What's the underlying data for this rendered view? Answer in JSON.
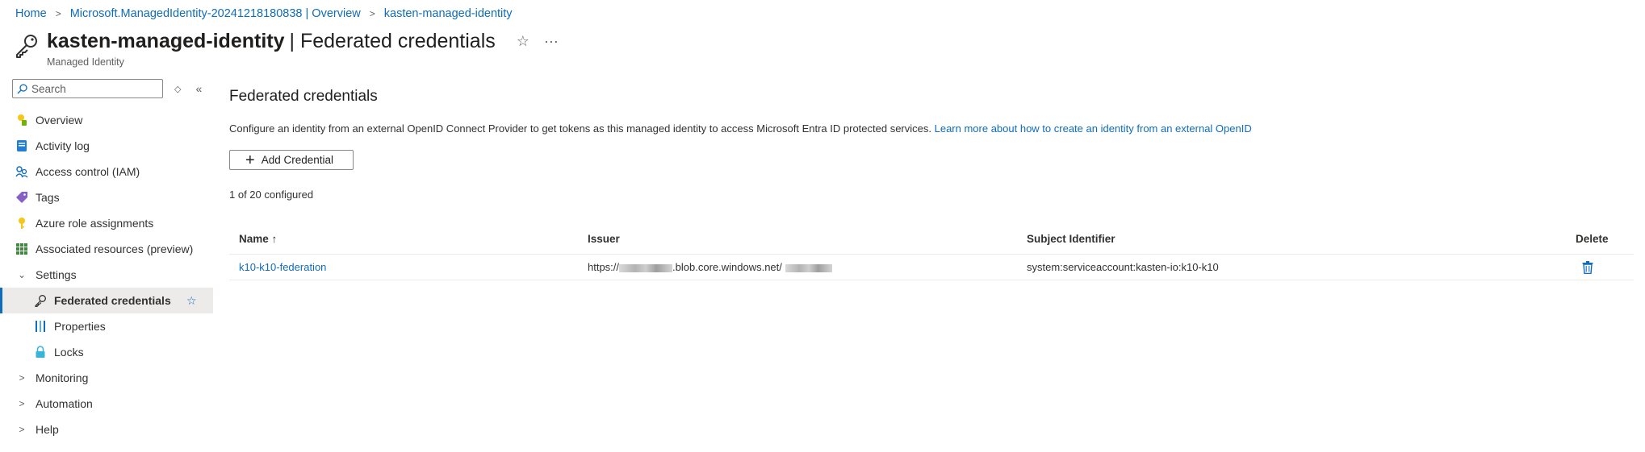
{
  "breadcrumb": {
    "home": "Home",
    "overview": "Microsoft.ManagedIdentity-20241218180838 | Overview",
    "current": "kasten-managed-identity"
  },
  "header": {
    "resource_name": "kasten-managed-identity",
    "page_name": "| Federated credentials",
    "subtitle": "Managed Identity",
    "favorite_icon": "star-icon",
    "more_icon": "ellipsis-icon"
  },
  "sidebar": {
    "search_placeholder": "Search",
    "items": [
      {
        "label": "Overview",
        "icon": "overview-icon"
      },
      {
        "label": "Activity log",
        "icon": "activity-log-icon"
      },
      {
        "label": "Access control (IAM)",
        "icon": "iam-icon"
      },
      {
        "label": "Tags",
        "icon": "tag-icon"
      },
      {
        "label": "Azure role assignments",
        "icon": "key-icon"
      },
      {
        "label": "Associated resources (preview)",
        "icon": "grid-icon"
      },
      {
        "label": "Settings",
        "icon": "chevron-down-icon"
      },
      {
        "label": "Federated credentials",
        "icon": "key-icon"
      },
      {
        "label": "Properties",
        "icon": "properties-icon"
      },
      {
        "label": "Locks",
        "icon": "lock-icon"
      },
      {
        "label": "Monitoring",
        "icon": "chevron-right-icon"
      },
      {
        "label": "Automation",
        "icon": "chevron-right-icon"
      },
      {
        "label": "Help",
        "icon": "chevron-right-icon"
      }
    ]
  },
  "main": {
    "title": "Federated credentials",
    "description": "Configure an identity from an external OpenID Connect Provider to get tokens as this managed identity to access Microsoft Entra ID protected services.",
    "learn_more": "Learn more about how to create an identity from an external OpenID",
    "add_button": "Add Credential",
    "configured_count": "1 of 20 configured"
  },
  "table": {
    "columns": [
      "Name ↑",
      "Issuer",
      "Subject Identifier",
      "Delete"
    ],
    "rows": [
      {
        "name": "k10-k10-federation",
        "issuer_prefix": "https://",
        "issuer_middle": ".blob.core.windows.net/",
        "subject": "system:serviceaccount:kasten-io:k10-k10"
      }
    ]
  },
  "colors": {
    "accent": "#0f6cbd",
    "text": "#323130",
    "border": "#8a8886"
  }
}
